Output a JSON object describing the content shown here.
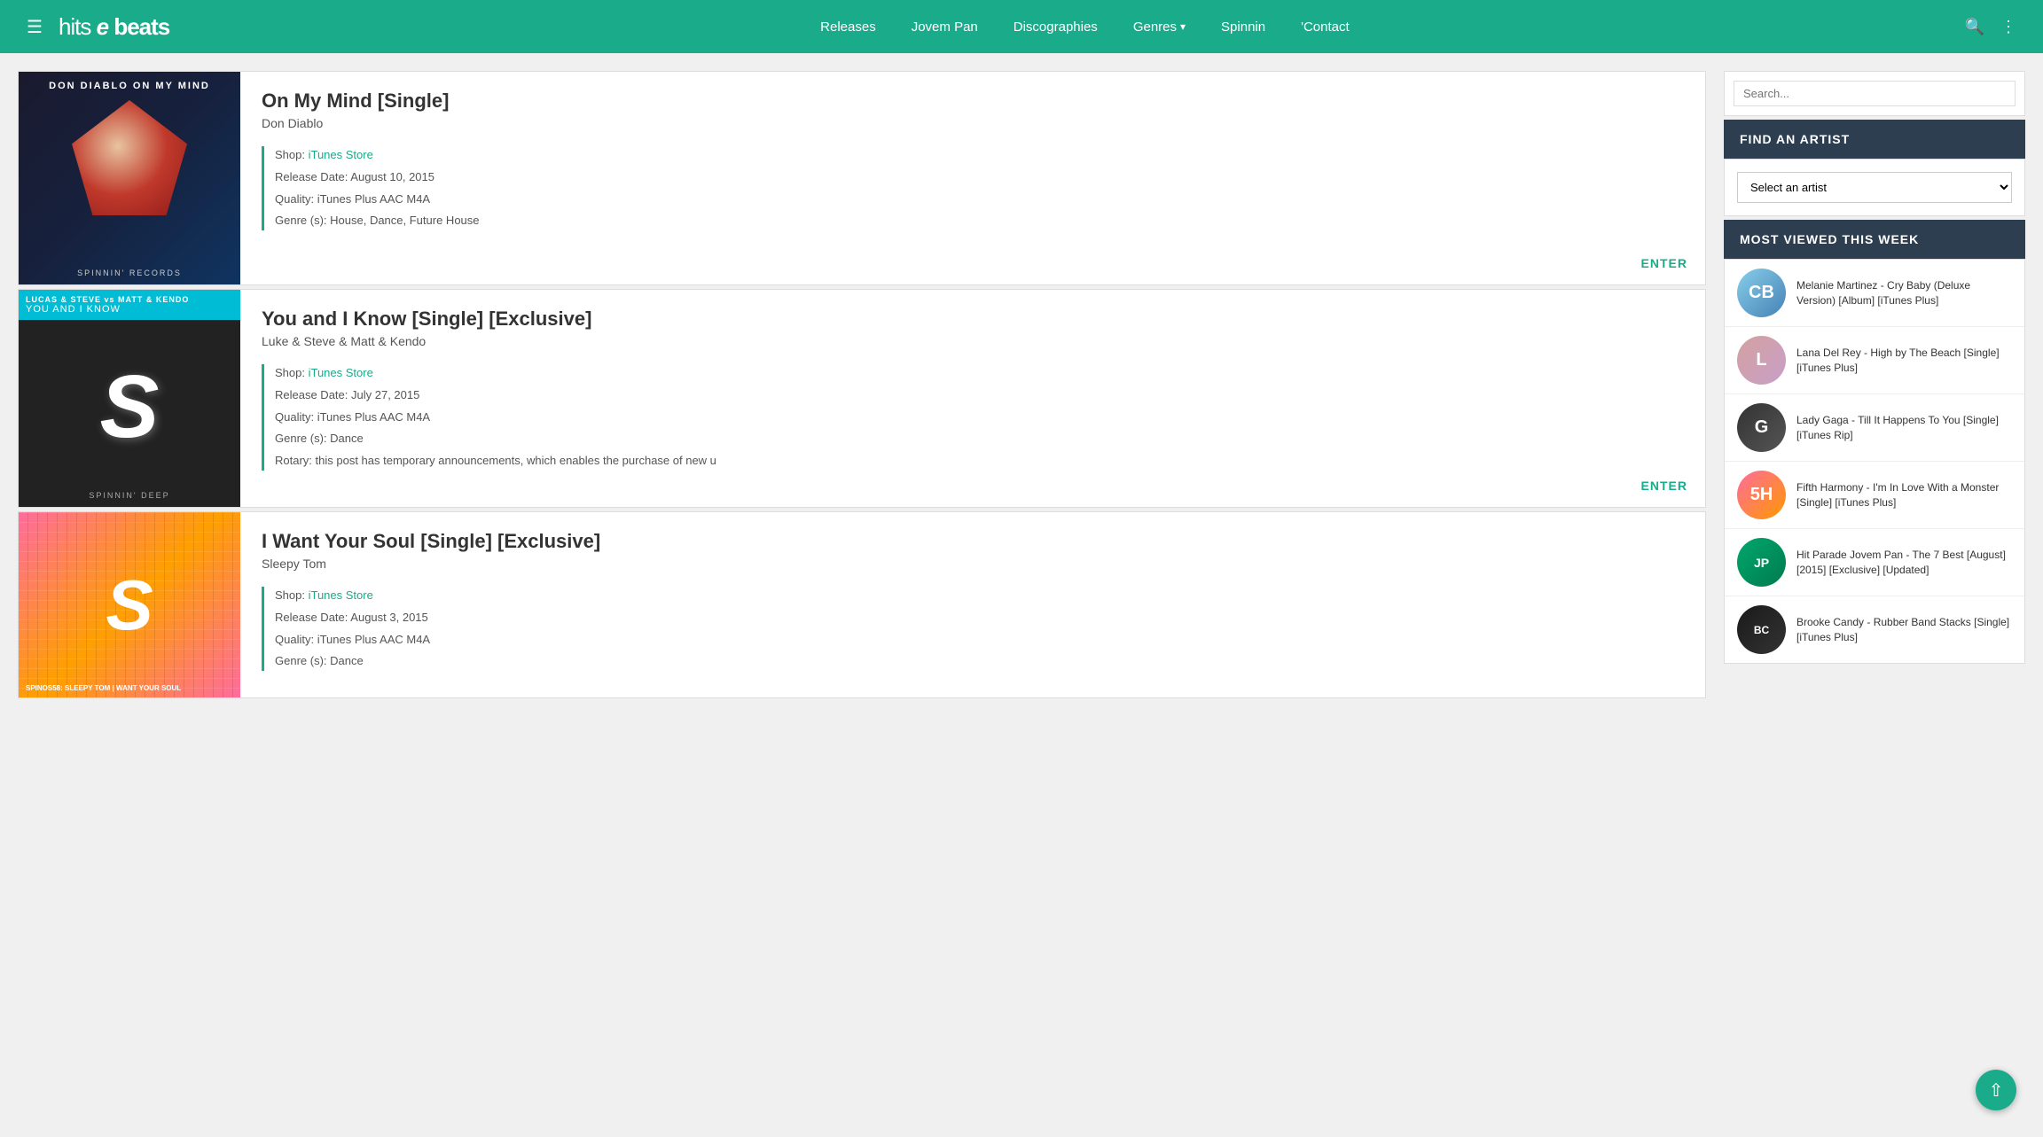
{
  "header": {
    "logo": "hits e beats",
    "nav": {
      "releases": "Releases",
      "jovemPan": "Jovem Pan",
      "discographies": "Discographies",
      "genres": "Genres",
      "spinnin": "Spinnin",
      "contact": "'Contact"
    }
  },
  "releases": [
    {
      "id": "on-my-mind",
      "title": "On My Mind [Single]",
      "artist": "Don Diablo",
      "shop_label": "Shop:",
      "shop_link": "iTunes Store",
      "shop_url": "#",
      "release_date_label": "Release Date:",
      "release_date": "August 10, 2015",
      "quality_label": "Quality:",
      "quality": "iTunes Plus AAC M4A",
      "genre_label": "Genre (s):",
      "genre": "House, Dance, Future House",
      "enter": "ENTER",
      "album_bg": "#1a1a2e",
      "top_text": "DON DIABLO ON MY MIND",
      "bottom_label": "SPINNIN' RECORDS"
    },
    {
      "id": "you-and-i-know",
      "title": "You and I Know [Single] [Exclusive]",
      "artist": "Luke & Steve & Matt & Kendo",
      "shop_label": "Shop:",
      "shop_link": "iTunes Store",
      "shop_url": "#",
      "release_date_label": "Release Date:",
      "release_date": "July 27, 2015",
      "quality_label": "Quality:",
      "quality": "iTunes Plus AAC M4A",
      "genre_label": "Genre (s):",
      "genre": "Dance",
      "rotary_label": "Rotary:",
      "rotary": "this post has temporary announcements, which enables the purchase of new u",
      "enter": "ENTER",
      "top_text": "LUCAS & STEVE vs MATT & KENDO\nYOU AND I KNOW",
      "bottom_label": "SPINNIN' DEEP"
    },
    {
      "id": "i-want-your-soul",
      "title": "I Want Your Soul [Single] [Exclusive]",
      "artist": "Sleepy Tom",
      "shop_label": "Shop:",
      "shop_link": "iTunes Store",
      "shop_url": "#",
      "release_date_label": "Release Date:",
      "release_date": "August 3, 2015",
      "quality_label": "Quality:",
      "quality": "iTunes Plus AAC M4A",
      "genre_label": "Genre (s):",
      "genre": "Dance",
      "enter": "ENTER",
      "artist_label": "SPINOS58: SLEEPY TOM | WANT YOUR SOUL"
    }
  ],
  "sidebar": {
    "find_artist_header": "FIND AN ARTIST",
    "find_artist_placeholder": "Select an artist",
    "most_viewed_header": "MOST VIEWED THIS WEEK",
    "most_viewed_items": [
      {
        "id": "crybaby",
        "text": "Melanie Martinez - Cry Baby (Deluxe Version) [Album] [iTunes Plus]",
        "thumb_class": "thumb-crybaby",
        "thumb_char": "CB"
      },
      {
        "id": "lana",
        "text": "Lana Del Rey - High by The Beach [Single] [iTunes Plus]",
        "thumb_class": "thumb-lana",
        "thumb_char": "L"
      },
      {
        "id": "gaga",
        "text": "Lady Gaga - Till It Happens To You [Single] [iTunes Rip]",
        "thumb_class": "thumb-gaga",
        "thumb_char": "G"
      },
      {
        "id": "fifth",
        "text": "Fifth Harmony - I'm In Love With a Monster [Single] [iTunes Plus]",
        "thumb_class": "thumb-fifthharmony",
        "thumb_char": "5H"
      },
      {
        "id": "jp",
        "text": "Hit Parade Jovem Pan - The 7 Best [August] [2015] [Exclusive] [Updated]",
        "thumb_class": "thumb-jp",
        "thumb_char": "JP"
      },
      {
        "id": "brooke",
        "text": "Brooke Candy - Rubber Band Stacks [Single] [iTunes Plus]",
        "thumb_class": "thumb-brooke",
        "thumb_char": "BC"
      }
    ]
  }
}
